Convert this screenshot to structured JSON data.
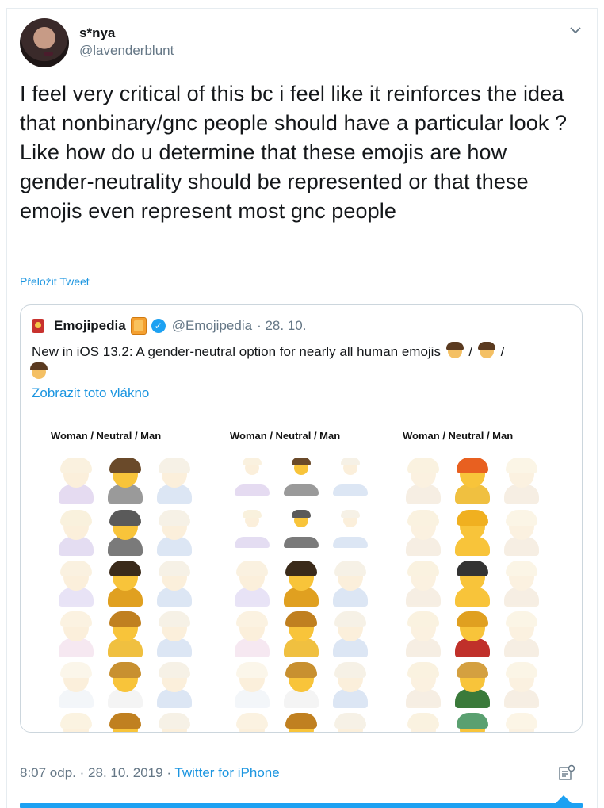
{
  "author": {
    "display_name": "s*nya",
    "handle": "@lavenderblunt",
    "avatar_icon": "avatar-photo"
  },
  "tweet": {
    "text": "I feel very critical of this bc i feel like it reinforces the idea that nonbinary/gnc people should have a particular look ? Like how do u determine that these emojis are how gender-neutrality should be represented or that these emojis even represent most gnc people",
    "translate_label": "Přeložit Tweet"
  },
  "quoted_tweet": {
    "name": "Emojipedia",
    "handle": "@Emojipedia",
    "date": "· 28. 10.",
    "text": "New in iOS 13.2: A gender-neutral option for nearly all human emojis",
    "separator": "/",
    "show_thread_label": "Zobrazit toto vlákno",
    "media": {
      "column_titles": [
        "Woman  /  Neutral  /  Man",
        "Woman  /  Neutral  /  Man",
        "Woman  /  Neutral  /  Man"
      ]
    }
  },
  "footer": {
    "time": "8:07 odp.",
    "date": "28. 10. 2019",
    "dot": "·",
    "source": "Twitter for iPhone"
  },
  "icons": {
    "menu": "chevron-down-icon",
    "analytics": "analytics-icon",
    "verified": "verified-badge-icon"
  },
  "colors": {
    "link": "#1b95e0",
    "accent": "#1da1f2",
    "muted": "#657786",
    "text": "#14171a"
  }
}
